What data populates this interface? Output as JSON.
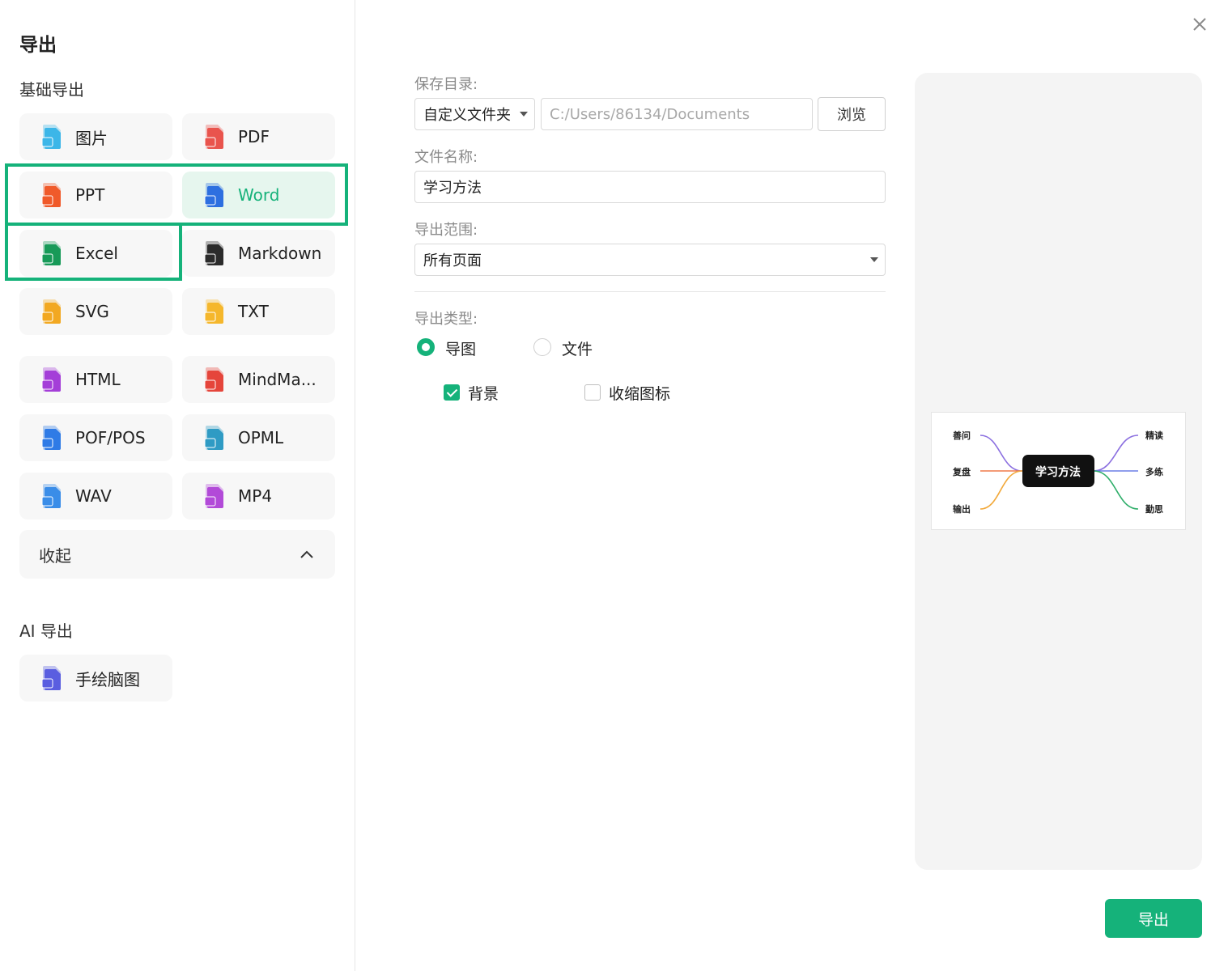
{
  "dialog": {
    "title": "导出"
  },
  "basic_section": {
    "title": "基础导出",
    "formats": [
      {
        "label": "图片",
        "icon": "image-file-icon",
        "color": "#3cb6e8"
      },
      {
        "label": "PDF",
        "icon": "pdf-file-icon",
        "color": "#e9544d"
      },
      {
        "label": "PPT",
        "icon": "ppt-file-icon",
        "color": "#f05a2a"
      },
      {
        "label": "Word",
        "icon": "word-file-icon",
        "color": "#2d6fe0",
        "selected": true
      },
      {
        "label": "Excel",
        "icon": "excel-file-icon",
        "color": "#179a58"
      },
      {
        "label": "Markdown",
        "icon": "markdown-file-icon",
        "color": "#2b2b2b"
      },
      {
        "label": "SVG",
        "icon": "svg-file-icon",
        "color": "#f2a821"
      },
      {
        "label": "TXT",
        "icon": "txt-file-icon",
        "color": "#f5b72c"
      },
      {
        "label": "HTML",
        "icon": "html-file-icon",
        "color": "#a43ed8"
      },
      {
        "label": "MindMa...",
        "icon": "mindmanager-file-icon",
        "color": "#e5453b"
      },
      {
        "label": "POF/POS",
        "icon": "pof-file-icon",
        "color": "#2f7be6"
      },
      {
        "label": "OPML",
        "icon": "opml-file-icon",
        "color": "#2f9bc4"
      },
      {
        "label": "WAV",
        "icon": "wav-file-icon",
        "color": "#3a8de8"
      },
      {
        "label": "MP4",
        "icon": "mp4-file-icon",
        "color": "#b24ad8"
      }
    ],
    "collapse_label": "收起"
  },
  "ai_section": {
    "title": "AI 导出",
    "formats": [
      {
        "label": "手绘脑图",
        "icon": "hand-drawn-file-icon",
        "color": "#5a5ee0"
      }
    ]
  },
  "form": {
    "save_dir_label": "保存目录:",
    "folder_select_value": "自定义文件夹",
    "path_placeholder": "C:/Users/86134/Documents",
    "browse_label": "浏览",
    "file_name_label": "文件名称:",
    "file_name_value": "学习方法",
    "range_label": "导出范围:",
    "range_value": "所有页面",
    "type_label": "导出类型:",
    "type_options": [
      {
        "label": "导图",
        "checked": true
      },
      {
        "label": "文件",
        "checked": false
      }
    ],
    "checkbox_options": [
      {
        "label": "背景",
        "checked": true
      },
      {
        "label": "收缩图标",
        "checked": false
      }
    ]
  },
  "preview": {
    "center_topic": "学习方法",
    "left_nodes": [
      "善问",
      "复盘",
      "输出"
    ],
    "right_nodes": [
      "精读",
      "多练",
      "勤思"
    ]
  },
  "actions": {
    "export_label": "导出"
  },
  "colors": {
    "accent": "#15b27a",
    "highlight": "#15b27a"
  }
}
